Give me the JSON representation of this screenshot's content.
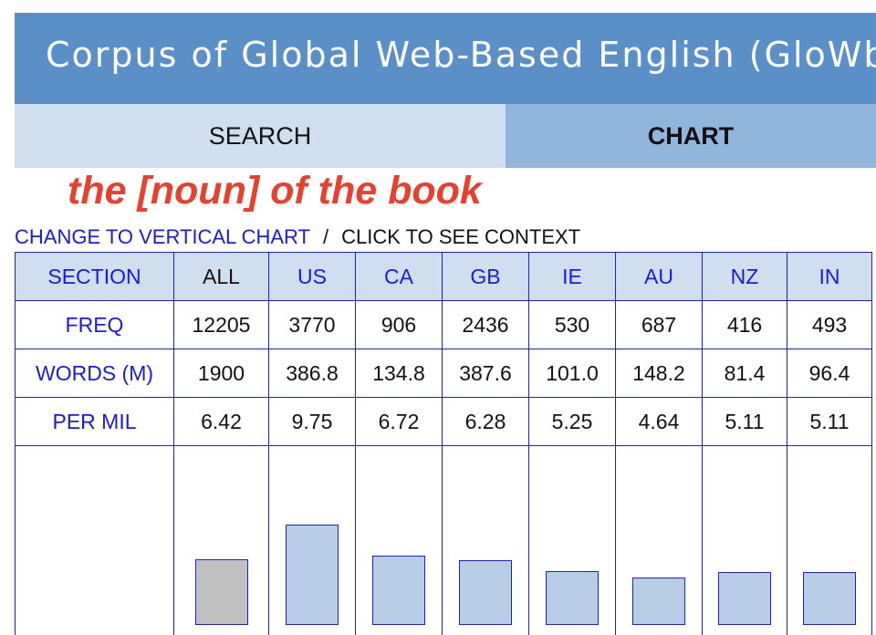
{
  "header": {
    "title": "Corpus of Global Web-Based English (GloWbE)"
  },
  "tabs": [
    {
      "label": "SEARCH"
    },
    {
      "label": "CHART"
    }
  ],
  "query": "the [noun] of the book",
  "links": {
    "vertical": "CHANGE TO VERTICAL CHART",
    "separator": "/",
    "context": "CLICK TO SEE CONTEXT"
  },
  "colors": {
    "header_bg": "#5b8fc7",
    "tab_inactive": "#d0dff0",
    "tab_active": "#92b5dc",
    "link": "#1a1adc",
    "query": "#e8402e",
    "bar": "#b8cde6",
    "bar_total": "#c0c0c0"
  },
  "chart_data": {
    "type": "table",
    "row_labels": [
      "SECTION",
      "FREQ",
      "WORDS (M)",
      "PER MIL"
    ],
    "columns": [
      "ALL",
      "US",
      "CA",
      "GB",
      "IE",
      "AU",
      "NZ",
      "IN"
    ],
    "freq": [
      "12205",
      "3770",
      "906",
      "2436",
      "530",
      "687",
      "416",
      "493"
    ],
    "words": [
      "1900",
      "386.8",
      "134.8",
      "387.6",
      "101.0",
      "148.2",
      "81.4",
      "96.4"
    ],
    "per_mil": [
      "6.42",
      "9.75",
      "6.72",
      "6.28",
      "5.25",
      "4.64",
      "5.11",
      "5.11"
    ],
    "per_mil_values": [
      6.42,
      9.75,
      6.72,
      6.28,
      5.25,
      4.64,
      5.11,
      5.11
    ]
  }
}
